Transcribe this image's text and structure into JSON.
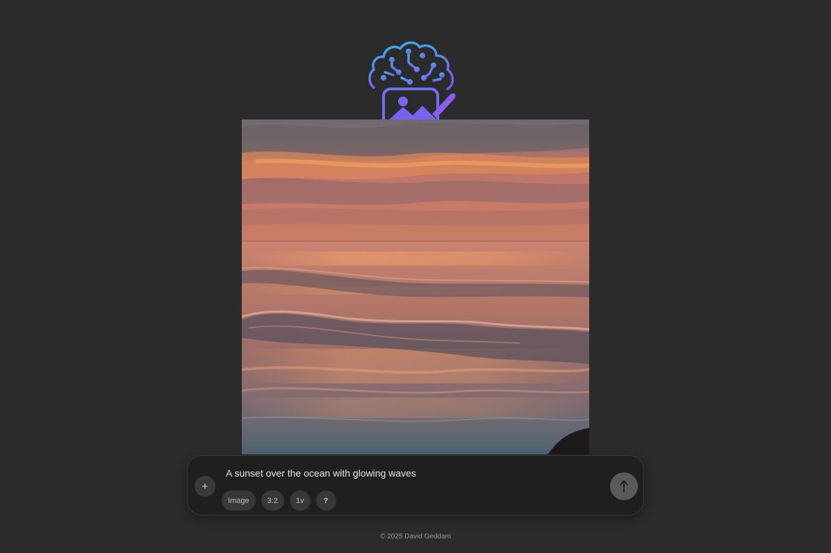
{
  "logo": {
    "icon": "brain-image-brush-icon",
    "gradient_start": "#2fb8e8",
    "gradient_end": "#7b5cf0"
  },
  "generated_image": {
    "description_icon": "sunset-ocean-image"
  },
  "prompt_bar": {
    "attach_label": "+",
    "prompt_text": "A sunset over the ocean with glowing waves",
    "chips": [
      {
        "label": "Image"
      },
      {
        "label": "3:2"
      },
      {
        "label": "1v"
      },
      {
        "label": "?"
      }
    ],
    "send_label": "↑"
  },
  "footer": {
    "text": "© 2025 David Geddam"
  },
  "colors": {
    "background": "#2b2b2b",
    "prompt_bar": "#1f1f1f",
    "chip": "#383838",
    "send_button": "#5a5a5a"
  }
}
